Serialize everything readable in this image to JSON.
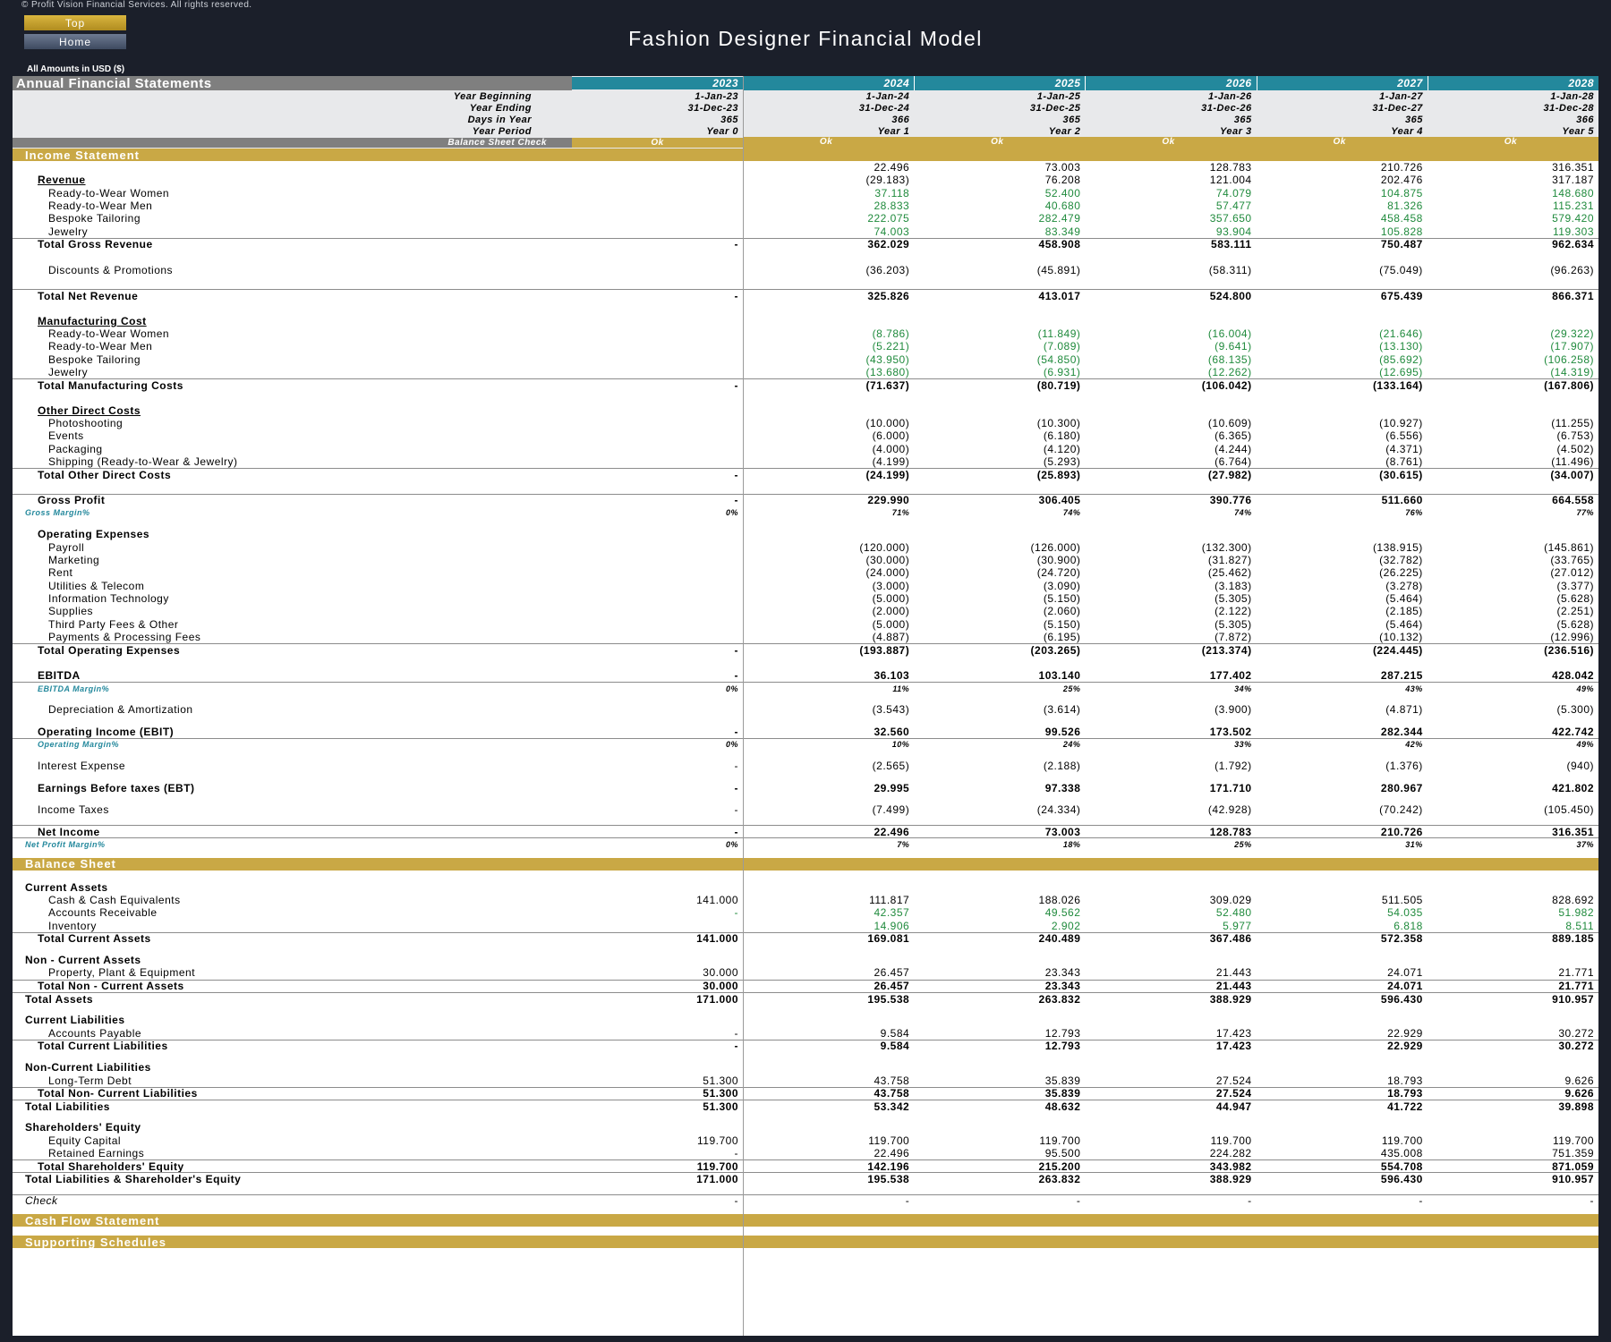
{
  "copyright": "© Profit Vision Financial Services. All rights reserved.",
  "nav": {
    "top_label": "Top",
    "home_label": "Home"
  },
  "page_title": "Fashion Designer Financial Model",
  "amounts_note": "All Amounts in  USD ($)",
  "header": {
    "title": "Annual Financial Statements",
    "years": [
      "2023",
      "2024",
      "2025",
      "2026",
      "2027",
      "2028"
    ],
    "info_rows": [
      {
        "label": "Year Beginning",
        "values": [
          "1-Jan-23",
          "1-Jan-24",
          "1-Jan-25",
          "1-Jan-26",
          "1-Jan-27",
          "1-Jan-28"
        ]
      },
      {
        "label": "Year Ending",
        "values": [
          "31-Dec-23",
          "31-Dec-24",
          "31-Dec-25",
          "31-Dec-26",
          "31-Dec-27",
          "31-Dec-28"
        ]
      },
      {
        "label": "Days in Year",
        "values": [
          "365",
          "366",
          "365",
          "365",
          "365",
          "366"
        ]
      },
      {
        "label": "Year Period",
        "values": [
          "Year 0",
          "Year 1",
          "Year 2",
          "Year 3",
          "Year 4",
          "Year 5"
        ]
      }
    ],
    "check_label": "Balance Sheet Check",
    "check_values": [
      "Ok",
      "Ok",
      "Ok",
      "Ok",
      "Ok",
      "Ok"
    ]
  },
  "sections": {
    "income_statement": "Income Statement",
    "balance_sheet": "Balance Sheet",
    "cash_flow": "Cash Flow Statement",
    "supporting": "Supporting Schedules"
  },
  "income": {
    "top_row": [
      "",
      "22.496",
      "73.003",
      "128.783",
      "210.726",
      "316.351"
    ],
    "revenue_heading": "Revenue",
    "revenue_heading_values": [
      "",
      "(29.183)",
      "76.208",
      "121.004",
      "202.476",
      "317.187"
    ],
    "revenue_items": [
      {
        "label": "Ready-to-Wear Women",
        "values": [
          "",
          "37.118",
          "52.400",
          "74.079",
          "104.875",
          "148.680"
        ]
      },
      {
        "label": "Ready-to-Wear Men",
        "values": [
          "",
          "28.833",
          "40.680",
          "57.477",
          "81.326",
          "115.231"
        ]
      },
      {
        "label": "Bespoke Tailoring",
        "values": [
          "",
          "222.075",
          "282.479",
          "357.650",
          "458.458",
          "579.420"
        ]
      },
      {
        "label": "Jewelry",
        "values": [
          "",
          "74.003",
          "83.349",
          "93.904",
          "105.828",
          "119.303"
        ]
      }
    ],
    "total_gross": {
      "label": "Total Gross Revenue",
      "values": [
        "-",
        "362.029",
        "458.908",
        "583.111",
        "750.487",
        "962.634"
      ]
    },
    "discounts": {
      "label": "Discounts & Promotions",
      "values": [
        "",
        "(36.203)",
        "(45.891)",
        "(58.311)",
        "(75.049)",
        "(96.263)"
      ]
    },
    "total_net": {
      "label": "Total Net Revenue",
      "values": [
        "-",
        "325.826",
        "413.017",
        "524.800",
        "675.439",
        "866.371"
      ]
    },
    "mfg_heading": "Manufacturing Cost",
    "mfg_items": [
      {
        "label": "Ready-to-Wear Women",
        "values": [
          "",
          "(8.786)",
          "(11.849)",
          "(16.004)",
          "(21.646)",
          "(29.322)"
        ]
      },
      {
        "label": "Ready-to-Wear Men",
        "values": [
          "",
          "(5.221)",
          "(7.089)",
          "(9.641)",
          "(13.130)",
          "(17.907)"
        ]
      },
      {
        "label": "Bespoke Tailoring",
        "values": [
          "",
          "(43.950)",
          "(54.850)",
          "(68.135)",
          "(85.692)",
          "(106.258)"
        ]
      },
      {
        "label": "Jewelry",
        "values": [
          "",
          "(13.680)",
          "(6.931)",
          "(12.262)",
          "(12.695)",
          "(14.319)"
        ]
      }
    ],
    "total_mfg": {
      "label": "Total Manufacturing Costs",
      "values": [
        "-",
        "(71.637)",
        "(80.719)",
        "(106.042)",
        "(133.164)",
        "(167.806)"
      ]
    },
    "odc_heading": "Other Direct Costs",
    "odc_items": [
      {
        "label": "Photoshooting",
        "values": [
          "",
          "(10.000)",
          "(10.300)",
          "(10.609)",
          "(10.927)",
          "(11.255)"
        ]
      },
      {
        "label": "Events",
        "values": [
          "",
          "(6.000)",
          "(6.180)",
          "(6.365)",
          "(6.556)",
          "(6.753)"
        ]
      },
      {
        "label": "Packaging",
        "values": [
          "",
          "(4.000)",
          "(4.120)",
          "(4.244)",
          "(4.371)",
          "(4.502)"
        ]
      },
      {
        "label": "Shipping (Ready-to-Wear & Jewelry)",
        "values": [
          "",
          "(4.199)",
          "(5.293)",
          "(6.764)",
          "(8.761)",
          "(11.496)"
        ]
      }
    ],
    "total_odc": {
      "label": "Total Other Direct Costs",
      "values": [
        "-",
        "(24.199)",
        "(25.893)",
        "(27.982)",
        "(30.615)",
        "(34.007)"
      ]
    },
    "gross_profit": {
      "label": "Gross Profit",
      "values": [
        "-",
        "229.990",
        "306.405",
        "390.776",
        "511.660",
        "664.558"
      ]
    },
    "gross_margin": {
      "label": "Gross Margin%",
      "values": [
        "0%",
        "71%",
        "74%",
        "74%",
        "76%",
        "77%"
      ]
    },
    "opex_heading": "Operating Expenses",
    "opex_items": [
      {
        "label": "Payroll",
        "values": [
          "",
          "(120.000)",
          "(126.000)",
          "(132.300)",
          "(138.915)",
          "(145.861)"
        ]
      },
      {
        "label": "Marketing",
        "values": [
          "",
          "(30.000)",
          "(30.900)",
          "(31.827)",
          "(32.782)",
          "(33.765)"
        ]
      },
      {
        "label": "Rent",
        "values": [
          "",
          "(24.000)",
          "(24.720)",
          "(25.462)",
          "(26.225)",
          "(27.012)"
        ]
      },
      {
        "label": "Utilities & Telecom",
        "values": [
          "",
          "(3.000)",
          "(3.090)",
          "(3.183)",
          "(3.278)",
          "(3.377)"
        ]
      },
      {
        "label": "Information Technology",
        "values": [
          "",
          "(5.000)",
          "(5.150)",
          "(5.305)",
          "(5.464)",
          "(5.628)"
        ]
      },
      {
        "label": "Supplies",
        "values": [
          "",
          "(2.000)",
          "(2.060)",
          "(2.122)",
          "(2.185)",
          "(2.251)"
        ]
      },
      {
        "label": "Third Party Fees & Other",
        "values": [
          "",
          "(5.000)",
          "(5.150)",
          "(5.305)",
          "(5.464)",
          "(5.628)"
        ]
      },
      {
        "label": "Payments & Processing Fees",
        "values": [
          "",
          "(4.887)",
          "(6.195)",
          "(7.872)",
          "(10.132)",
          "(12.996)"
        ]
      }
    ],
    "total_opex": {
      "label": "Total Operating Expenses",
      "values": [
        "-",
        "(193.887)",
        "(203.265)",
        "(213.374)",
        "(224.445)",
        "(236.516)"
      ]
    },
    "ebitda": {
      "label": "EBITDA",
      "values": [
        "-",
        "36.103",
        "103.140",
        "177.402",
        "287.215",
        "428.042"
      ]
    },
    "ebitda_margin": {
      "label": "EBITDA Margin%",
      "values": [
        "0%",
        "11%",
        "25%",
        "34%",
        "43%",
        "49%"
      ]
    },
    "da": {
      "label": "Depreciation & Amortization",
      "values": [
        "",
        "(3.543)",
        "(3.614)",
        "(3.900)",
        "(4.871)",
        "(5.300)"
      ]
    },
    "ebit": {
      "label": "Operating Income (EBIT)",
      "values": [
        "-",
        "32.560",
        "99.526",
        "173.502",
        "282.344",
        "422.742"
      ]
    },
    "op_margin": {
      "label": "Operating Margin%",
      "values": [
        "0%",
        "10%",
        "24%",
        "33%",
        "42%",
        "49%"
      ]
    },
    "interest": {
      "label": "Interest Expense",
      "values": [
        "-",
        "(2.565)",
        "(2.188)",
        "(1.792)",
        "(1.376)",
        "(940)"
      ]
    },
    "ebt": {
      "label": "Earnings Before taxes (EBT)",
      "values": [
        "-",
        "29.995",
        "97.338",
        "171.710",
        "280.967",
        "421.802"
      ]
    },
    "taxes": {
      "label": "Income Taxes",
      "values": [
        "-",
        "(7.499)",
        "(24.334)",
        "(42.928)",
        "(70.242)",
        "(105.450)"
      ]
    },
    "net_income": {
      "label": "Net Income",
      "values": [
        "-",
        "22.496",
        "73.003",
        "128.783",
        "210.726",
        "316.351"
      ]
    },
    "net_margin": {
      "label": "Net Profit Margin%",
      "values": [
        "0%",
        "7%",
        "18%",
        "25%",
        "31%",
        "37%"
      ]
    }
  },
  "balance": {
    "current_assets_heading": "Current Assets",
    "current_assets": [
      {
        "label": "Cash & Cash Equivalents",
        "values": [
          "141.000",
          "111.817",
          "188.026",
          "309.029",
          "511.505",
          "828.692"
        ],
        "green": false
      },
      {
        "label": "Accounts Receivable",
        "values": [
          "-",
          "42.357",
          "49.562",
          "52.480",
          "54.035",
          "51.982"
        ],
        "green": true
      },
      {
        "label": "Inventory",
        "values": [
          "",
          "14.906",
          "2.902",
          "5.977",
          "6.818",
          "8.511"
        ],
        "green": true
      }
    ],
    "total_current_assets": {
      "label": "Total Current Assets",
      "values": [
        "141.000",
        "169.081",
        "240.489",
        "367.486",
        "572.358",
        "889.185"
      ]
    },
    "noncurrent_heading": "Non - Current Assets",
    "ppe": {
      "label": "Property, Plant & Equipment",
      "values": [
        "30.000",
        "26.457",
        "23.343",
        "21.443",
        "24.071",
        "21.771"
      ]
    },
    "total_noncurrent": {
      "label": "Total Non - Current Assets",
      "values": [
        "30.000",
        "26.457",
        "23.343",
        "21.443",
        "24.071",
        "21.771"
      ]
    },
    "total_assets": {
      "label": "Total Assets",
      "values": [
        "171.000",
        "195.538",
        "263.832",
        "388.929",
        "596.430",
        "910.957"
      ]
    },
    "current_liab_heading": "Current Liabilities",
    "ap": {
      "label": "Accounts Payable",
      "values": [
        "-",
        "9.584",
        "12.793",
        "17.423",
        "22.929",
        "30.272"
      ]
    },
    "total_current_liab": {
      "label": "Total Current Liabilities",
      "values": [
        "-",
        "9.584",
        "12.793",
        "17.423",
        "22.929",
        "30.272"
      ]
    },
    "noncurrent_liab_heading": "Non-Current Liabilities",
    "ltd": {
      "label": "Long-Term Debt",
      "values": [
        "51.300",
        "43.758",
        "35.839",
        "27.524",
        "18.793",
        "9.626"
      ]
    },
    "total_noncurrent_liab": {
      "label": "Total Non- Current Liabilities",
      "values": [
        "51.300",
        "43.758",
        "35.839",
        "27.524",
        "18.793",
        "9.626"
      ]
    },
    "total_liab": {
      "label": "Total Liabilities",
      "values": [
        "51.300",
        "53.342",
        "48.632",
        "44.947",
        "41.722",
        "39.898"
      ]
    },
    "equity_heading": "Shareholders' Equity",
    "equity_capital": {
      "label": "Equity Capital",
      "values": [
        "119.700",
        "119.700",
        "119.700",
        "119.700",
        "119.700",
        "119.700"
      ]
    },
    "retained": {
      "label": "Retained Earnings",
      "values": [
        "-",
        "22.496",
        "95.500",
        "224.282",
        "435.008",
        "751.359"
      ]
    },
    "total_equity": {
      "label": "Total Shareholders' Equity",
      "values": [
        "119.700",
        "142.196",
        "215.200",
        "343.982",
        "554.708",
        "871.059"
      ]
    },
    "total_le": {
      "label": "Total Liabilities & Shareholder's Equity",
      "values": [
        "171.000",
        "195.538",
        "263.832",
        "388.929",
        "596.430",
        "910.957"
      ]
    },
    "check": {
      "label": "Check",
      "values": [
        "-",
        "-",
        "-",
        "-",
        "-",
        "-"
      ]
    }
  }
}
